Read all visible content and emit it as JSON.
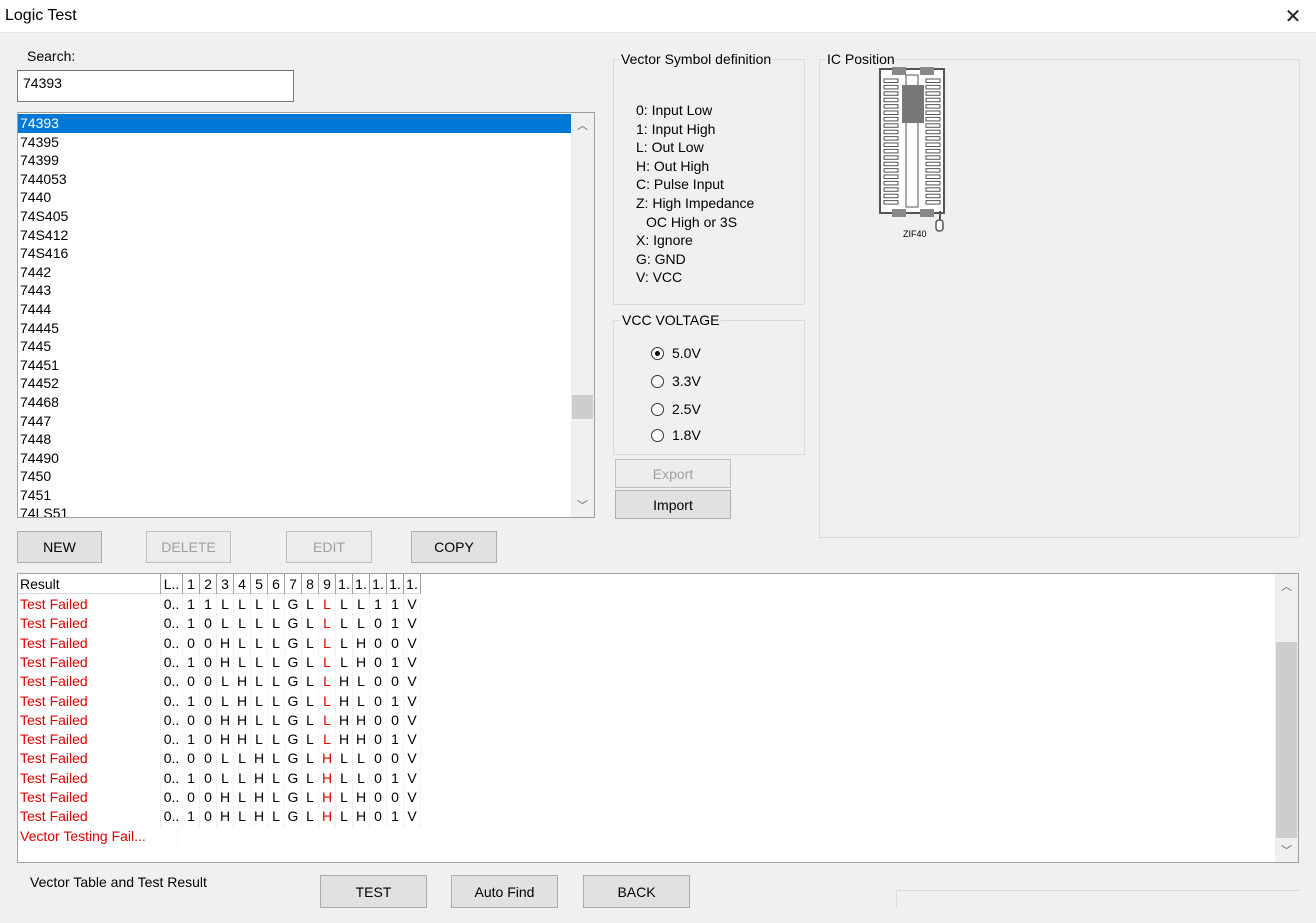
{
  "window": {
    "title": "Logic Test"
  },
  "search": {
    "label": "Search:",
    "value": "74393"
  },
  "ic_list": {
    "items": [
      "74393",
      "74395",
      "74399",
      "744053",
      "7440",
      "74S405",
      "74S412",
      "74S416",
      "7442",
      "7443",
      "7444",
      "74445",
      "7445",
      "74451",
      "74452",
      "74468",
      "7447",
      "7448",
      "74490",
      "7450",
      "7451",
      "74LS51"
    ],
    "selected": "74393",
    "scroll_position": 0.72
  },
  "buttons": {
    "new": "NEW",
    "delete": "DELETE",
    "edit": "EDIT",
    "copy": "COPY",
    "export": "Export",
    "import": "Import",
    "test": "TEST",
    "auto_find": "Auto Find",
    "back": "BACK"
  },
  "vector_symbols": {
    "title": "Vector Symbol definition",
    "lines": [
      "0: Input Low",
      "1: Input High",
      "L: Out Low",
      "H: Out High",
      "C: Pulse Input",
      "Z: High Impedance",
      "OC High or 3S",
      "X: Ignore",
      "G: GND",
      "V: VCC"
    ]
  },
  "vcc": {
    "title": "VCC VOLTAGE",
    "options": [
      "5.0V",
      "3.3V",
      "2.5V",
      "1.8V"
    ],
    "selected": "5.0V"
  },
  "ic_position": {
    "title": "IC Position",
    "socket_label": "ZIF40"
  },
  "results": {
    "headers": [
      "Result",
      "L..",
      "1",
      "2",
      "3",
      "4",
      "5",
      "6",
      "7",
      "8",
      "9",
      "1.",
      "1.",
      "1.",
      "1.",
      "1."
    ],
    "rows": [
      {
        "result": "Test Failed",
        "cells": [
          "0..",
          "1",
          "1",
          "L",
          "L",
          "L",
          "L",
          "G",
          "L",
          "L",
          "L",
          "L",
          "1",
          "1",
          "V"
        ],
        "fail_col": 9
      },
      {
        "result": "Test Failed",
        "cells": [
          "0..",
          "1",
          "0",
          "L",
          "L",
          "L",
          "L",
          "G",
          "L",
          "L",
          "L",
          "L",
          "0",
          "1",
          "V"
        ],
        "fail_col": 9
      },
      {
        "result": "Test Failed",
        "cells": [
          "0..",
          "0",
          "0",
          "H",
          "L",
          "L",
          "L",
          "G",
          "L",
          "L",
          "L",
          "H",
          "0",
          "0",
          "V"
        ],
        "fail_col": 9
      },
      {
        "result": "Test Failed",
        "cells": [
          "0..",
          "1",
          "0",
          "H",
          "L",
          "L",
          "L",
          "G",
          "L",
          "L",
          "L",
          "H",
          "0",
          "1",
          "V"
        ],
        "fail_col": 9
      },
      {
        "result": "Test Failed",
        "cells": [
          "0..",
          "0",
          "0",
          "L",
          "H",
          "L",
          "L",
          "G",
          "L",
          "L",
          "H",
          "L",
          "0",
          "0",
          "V"
        ],
        "fail_col": 9
      },
      {
        "result": "Test Failed",
        "cells": [
          "0..",
          "1",
          "0",
          "L",
          "H",
          "L",
          "L",
          "G",
          "L",
          "L",
          "H",
          "L",
          "0",
          "1",
          "V"
        ],
        "fail_col": 9
      },
      {
        "result": "Test Failed",
        "cells": [
          "0..",
          "0",
          "0",
          "H",
          "H",
          "L",
          "L",
          "G",
          "L",
          "L",
          "H",
          "H",
          "0",
          "0",
          "V"
        ],
        "fail_col": 9
      },
      {
        "result": "Test Failed",
        "cells": [
          "0..",
          "1",
          "0",
          "H",
          "H",
          "L",
          "L",
          "G",
          "L",
          "L",
          "H",
          "H",
          "0",
          "1",
          "V"
        ],
        "fail_col": 9
      },
      {
        "result": "Test Failed",
        "cells": [
          "0..",
          "0",
          "0",
          "L",
          "L",
          "H",
          "L",
          "G",
          "L",
          "H",
          "L",
          "L",
          "0",
          "0",
          "V"
        ],
        "fail_col": 9
      },
      {
        "result": "Test Failed",
        "cells": [
          "0..",
          "1",
          "0",
          "L",
          "L",
          "H",
          "L",
          "G",
          "L",
          "H",
          "L",
          "L",
          "0",
          "1",
          "V"
        ],
        "fail_col": 9
      },
      {
        "result": "Test Failed",
        "cells": [
          "0..",
          "0",
          "0",
          "H",
          "L",
          "H",
          "L",
          "G",
          "L",
          "H",
          "L",
          "H",
          "0",
          "0",
          "V"
        ],
        "fail_col": 9
      },
      {
        "result": "Test Failed",
        "cells": [
          "0..",
          "1",
          "0",
          "H",
          "L",
          "H",
          "L",
          "G",
          "L",
          "H",
          "L",
          "H",
          "0",
          "1",
          "V"
        ],
        "fail_col": 9
      },
      {
        "result": "Vector Testing Fail...",
        "cells": [],
        "fail_col": -1
      }
    ]
  },
  "footer": {
    "label": "Vector Table and Test Result"
  },
  "colors": {
    "selection": "#0078d7",
    "fail": "#e00000"
  }
}
